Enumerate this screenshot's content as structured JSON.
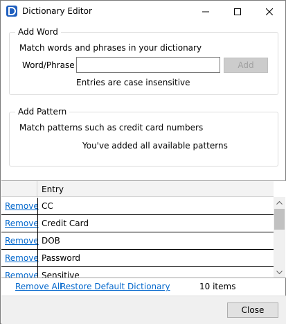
{
  "window": {
    "title": "Dictionary Editor"
  },
  "add_word": {
    "legend": "Add Word",
    "description": "Match words and phrases in your dictionary",
    "field_label": "Word/Phrase",
    "field_value": "",
    "add_button": "Add",
    "note": "Entries are case insensitive"
  },
  "add_pattern": {
    "legend": "Add Pattern",
    "description": "Match patterns such as credit card numbers",
    "status": "You've added all available patterns"
  },
  "table": {
    "column_header": "Entry",
    "remove_label": "Remove",
    "rows": [
      "CC",
      "Credit Card",
      "DOB",
      "Password",
      "Sensitive"
    ]
  },
  "actions": {
    "remove_all": "Remove All",
    "restore_default": "Restore Default Dictionary",
    "item_count": "10 items"
  },
  "footer": {
    "close_button": "Close"
  },
  "colors": {
    "link": "#0066cc",
    "app_icon": "#1f5fbf"
  }
}
